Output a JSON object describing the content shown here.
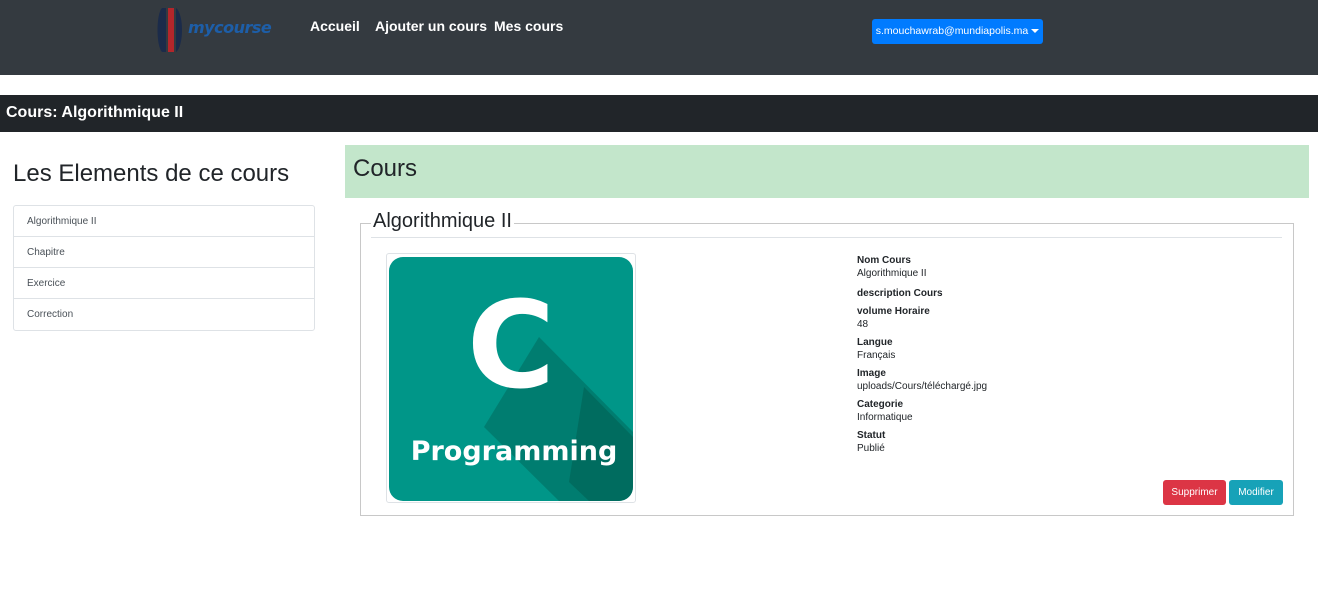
{
  "brand": {
    "logo_text": "mycourse",
    "logo_icon": "brand-logo-icon",
    "logo_color": "#1d5ea8"
  },
  "nav": {
    "links": [
      "Accueil",
      "Ajouter un cours",
      "Mes cours"
    ],
    "user_email": "s.mouchawrab@mundiapolis.ma"
  },
  "course_bar": {
    "title": "Cours: Algorithmique II"
  },
  "sidebar": {
    "title": "Les Elements de ce cours",
    "items": [
      "Algorithmique II",
      "Chapitre",
      "Exercice",
      "Correction"
    ]
  },
  "main": {
    "section_title": "Cours",
    "course_name": "Algorithmique II",
    "image": {
      "big_letter": "C",
      "caption": "Programming",
      "bg_color": "#009688"
    },
    "details": [
      {
        "label": "Nom Cours",
        "value": "Algorithmique II"
      },
      {
        "label": "description Cours",
        "value": ""
      },
      {
        "label": "volume Horaire",
        "value": "48"
      },
      {
        "label": "Langue",
        "value": "Français"
      },
      {
        "label": "Image",
        "value": "uploads/Cours/téléchargé.jpg"
      },
      {
        "label": "Categorie",
        "value": "Informatique"
      },
      {
        "label": "Statut",
        "value": "Publié"
      }
    ],
    "buttons": {
      "delete": "Supprimer",
      "edit": "Modifier"
    }
  },
  "colors": {
    "navbar": "#343a40",
    "course_bar": "#212529",
    "section_header": "#c3e6cb",
    "primary": "#007bff",
    "danger": "#dc3545",
    "info": "#17a2b8"
  }
}
